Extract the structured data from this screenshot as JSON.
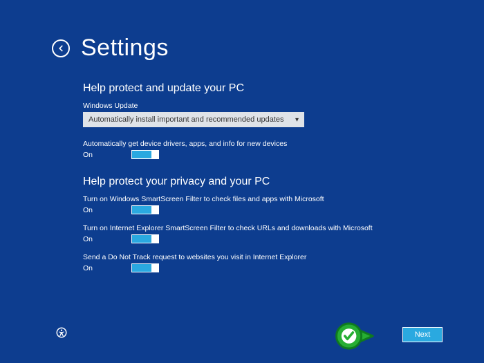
{
  "page_title": "Settings",
  "section1": {
    "heading": "Help protect and update your PC",
    "update_label": "Windows Update",
    "update_selected": "Automatically install important and recommended updates",
    "opt1": {
      "desc": "Automatically get device drivers, apps, and info for new devices",
      "state": "On"
    }
  },
  "section2": {
    "heading": "Help protect your privacy and your PC",
    "opt1": {
      "desc": "Turn on Windows SmartScreen Filter to check files and apps with Microsoft",
      "state": "On"
    },
    "opt2": {
      "desc": "Turn on Internet Explorer SmartScreen Filter to check URLs and downloads with Microsoft",
      "state": "On"
    },
    "opt3": {
      "desc": "Send a Do Not Track request to websites you visit in Internet Explorer",
      "state": "On"
    }
  },
  "next_label": "Next"
}
